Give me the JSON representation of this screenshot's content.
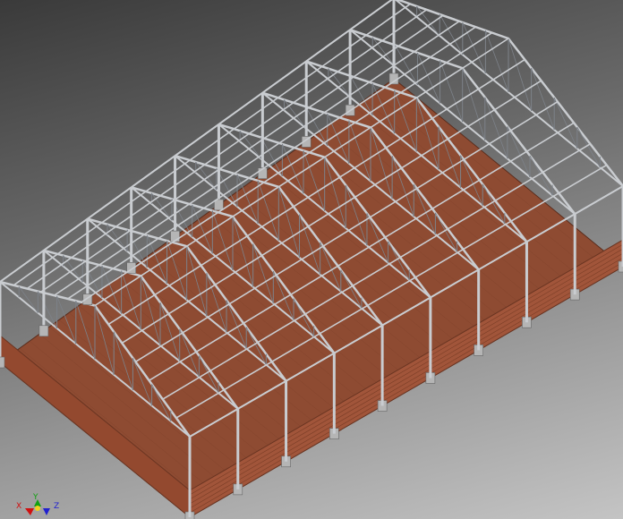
{
  "viewport": {
    "background_top": "#3a3a3a",
    "background_bottom": "#c4c4c4"
  },
  "model": {
    "floor_color": "#8e4b32",
    "brick_wall_color": "#a1553a",
    "steel_color": "#c9ccd0",
    "steel_edge_color": "#7d8289",
    "footing_color": "#b5b5b5"
  },
  "axis_triad": {
    "x_label": "X",
    "y_label": "Y",
    "z_label": "Z",
    "x_color": "#d01010",
    "y_color": "#10a010",
    "z_color": "#2020d0"
  }
}
